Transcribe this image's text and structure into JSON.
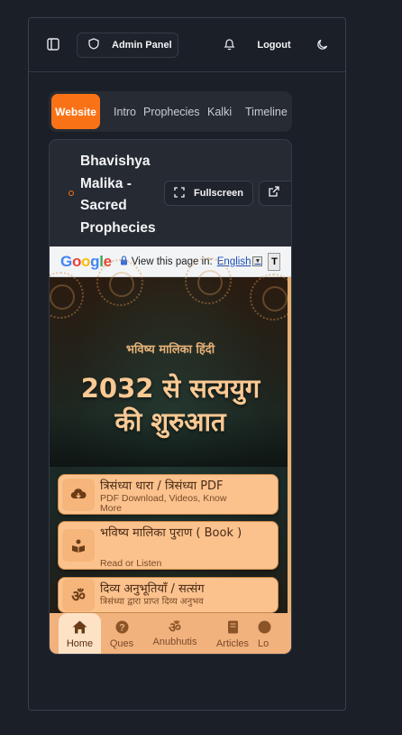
{
  "header": {
    "admin_panel_label": "Admin Panel",
    "logout_label": "Logout",
    "icons": [
      "sidebar-toggle-icon",
      "shield-icon",
      "bell-icon",
      "moon-icon"
    ]
  },
  "tabs": [
    {
      "label": "Website",
      "active": true
    },
    {
      "label": "Intro",
      "active": false
    },
    {
      "label": "Prophecies",
      "active": false
    },
    {
      "label": "Kalki",
      "active": false
    },
    {
      "label": "Timeline",
      "active": false
    }
  ],
  "card": {
    "title": "Bhavishya Malika - Sacred Prophecies",
    "fullscreen_label": "Fullscreen",
    "accent_color": "#f97316"
  },
  "preview": {
    "translate_bar": {
      "logo": "Google",
      "view_text": "View this page in:",
      "language": "English",
      "extra": "T"
    },
    "hero_small": "भविष्य मालिका हिंदी",
    "hero_line1": "2032 से सत्ययुग",
    "hero_line2": "की शुरुआत",
    "items": [
      {
        "title": "त्रिसंध्या धारा / त्रिसंध्या PDF",
        "subtitle": "PDF Download, Videos, Know More",
        "icon": "download-cloud-icon"
      },
      {
        "title": "भविष्य मालिका पुराण ( Book )",
        "subtitle": "Read or Listen",
        "icon": "book-reader-icon"
      },
      {
        "title": "दिव्य अनुभूतियाँ / सत्संग",
        "subtitle": "त्रिसंध्या द्वारा प्राप्त दिव्य अनुभव",
        "icon": "om-icon"
      }
    ],
    "bottom_nav": [
      {
        "label": "Home",
        "icon": "home-icon",
        "active": true
      },
      {
        "label": "Ques",
        "icon": "question-icon",
        "active": false
      },
      {
        "label": "Anubhutis",
        "icon": "om-icon",
        "active": false
      },
      {
        "label": "Articles",
        "icon": "book-icon",
        "active": false
      },
      {
        "label": "Lo",
        "icon": "location-icon",
        "active": false
      }
    ]
  }
}
